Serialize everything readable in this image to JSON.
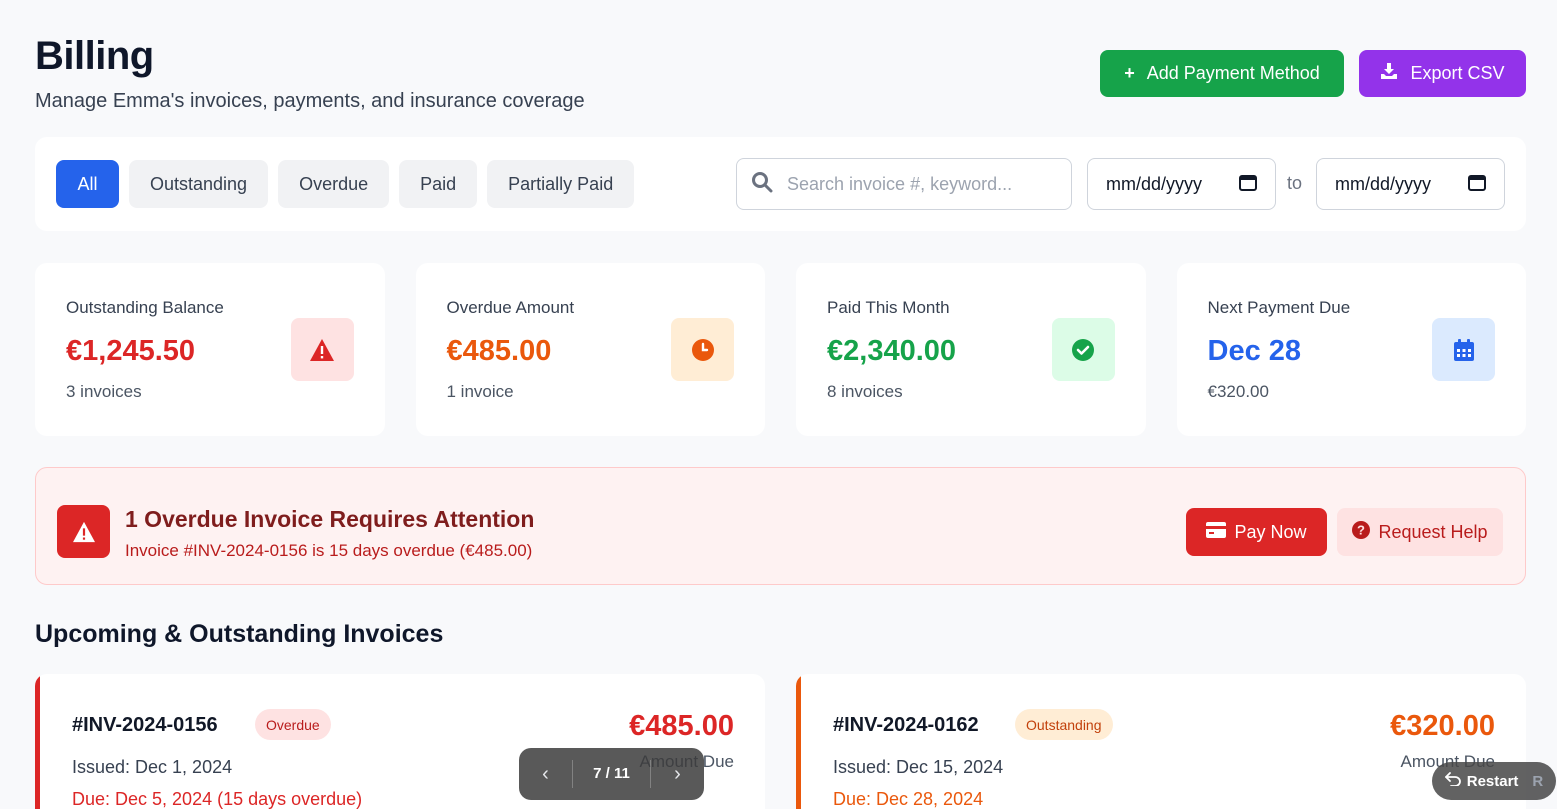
{
  "header": {
    "title": "Billing",
    "subtitle": "Manage Emma's invoices, payments, and insurance coverage",
    "add_payment_label": "Add Payment Method",
    "export_label": "Export CSV"
  },
  "filters": {
    "chips": [
      "All",
      "Outstanding",
      "Overdue",
      "Paid",
      "Partially Paid"
    ],
    "active_chip": "All",
    "search_placeholder": "Search invoice #, keyword...",
    "date_from": "mm/dd/yyyy",
    "date_to_label": "to",
    "date_to": "mm/dd/yyyy"
  },
  "stats": [
    {
      "label": "Outstanding Balance",
      "value": "€1,245.50",
      "sub": "3 invoices",
      "icon": "warning-icon",
      "color": "#dc2626",
      "icon_bg": "#fee2e2"
    },
    {
      "label": "Overdue Amount",
      "value": "€485.00",
      "sub": "1 invoice",
      "icon": "clock-icon",
      "color": "#ea580c",
      "icon_bg": "#ffedd5"
    },
    {
      "label": "Paid This Month",
      "value": "€2,340.00",
      "sub": "8 invoices",
      "icon": "check-circle-icon",
      "color": "#16a34a",
      "icon_bg": "#dcfce7"
    },
    {
      "label": "Next Payment Due",
      "value": "Dec 28",
      "sub": "€320.00",
      "icon": "calendar-icon",
      "color": "#2563eb",
      "icon_bg": "#dbeafe"
    }
  ],
  "alert": {
    "title": "1 Overdue Invoice Requires Attention",
    "text": "Invoice #INV-2024-0156 is 15 days overdue (€485.00)",
    "pay_now_label": "Pay Now",
    "request_help_label": "Request Help"
  },
  "section_title": "Upcoming & Outstanding Invoices",
  "invoices": [
    {
      "id": "#INV-2024-0156",
      "status": "Overdue",
      "amount": "€485.00",
      "amount_label": "Amount Due",
      "issued": "Issued: Dec 1, 2024",
      "due": "Due: Dec 5, 2024 (15 days overdue)",
      "accent": "#dc2626",
      "badge_bg": "#fee2e2",
      "badge_fg": "#b91c1c"
    },
    {
      "id": "#INV-2024-0162",
      "status": "Outstanding",
      "amount": "€320.00",
      "amount_label": "Amount Due",
      "issued": "Issued: Dec 15, 2024",
      "due": "Due: Dec 28, 2024",
      "accent": "#ea580c",
      "badge_bg": "#ffedd5",
      "badge_fg": "#c2410c"
    }
  ],
  "pager": {
    "label": "7 / 11"
  },
  "restart": {
    "label": "Restart",
    "key": "R"
  }
}
